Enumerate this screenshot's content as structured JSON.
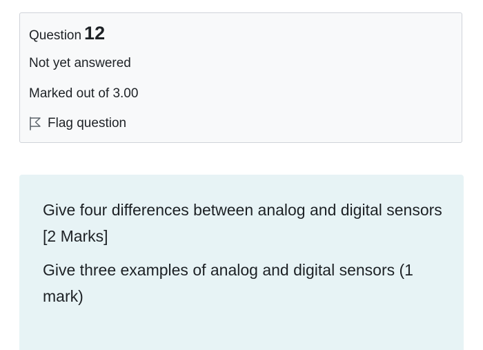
{
  "info": {
    "question_word": "Question",
    "question_number": "12",
    "state": "Not yet answered",
    "grade": "Marked out of 3.00",
    "flag_label": "Flag question"
  },
  "question": {
    "paragraphs": [
      "Give four differences between analog and digital sensors [2 Marks]",
      "Give three examples of analog and digital sensors (1 mark)"
    ]
  },
  "icons": {
    "flag": "flag-icon"
  }
}
